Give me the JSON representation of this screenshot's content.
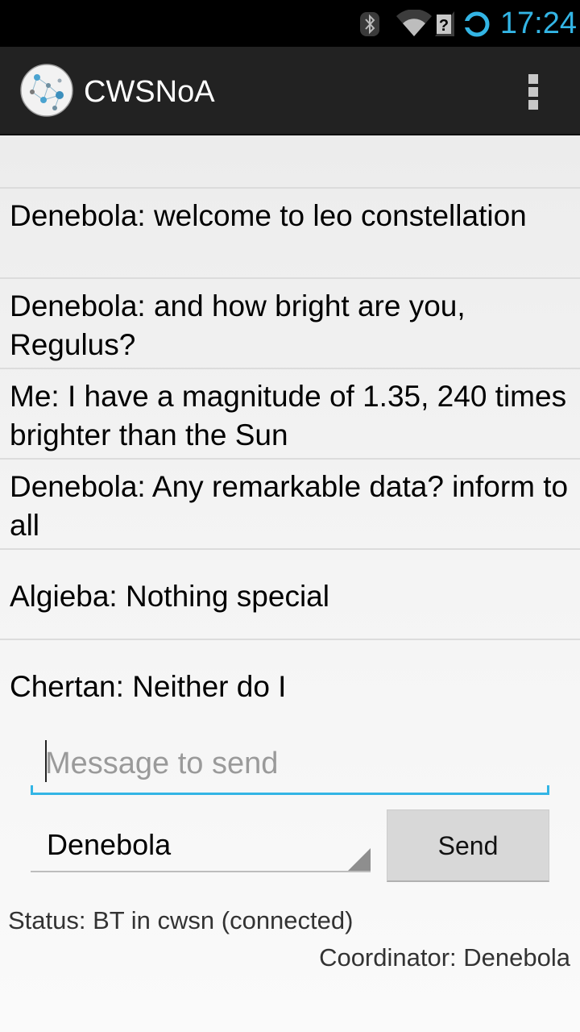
{
  "status_bar": {
    "time": "17:24",
    "icons": [
      "bluetooth-icon",
      "wifi-icon",
      "no-signal-icon",
      "sync-icon"
    ],
    "clock_color": "#33b5e5"
  },
  "app_bar": {
    "title": "CWSNoA",
    "logo_icon": "network-nodes-icon",
    "menu_icon": "overflow-menu-icon"
  },
  "messages": [
    {
      "text": "Denebola: welcome to leo constellation"
    },
    {
      "text": "Denebola: and how bright are you, Regulus?"
    },
    {
      "text": "Me: I have a magnitude of 1.35, 240 times brighter than the Sun"
    },
    {
      "text": "Denebola: Any remarkable data? inform to all"
    },
    {
      "text": "Algieba: Nothing special"
    },
    {
      "text": "Chertan: Neither do I"
    }
  ],
  "compose": {
    "placeholder": "Message to send",
    "value": "",
    "recipient": "Denebola",
    "send_label": "Send",
    "accent_color": "#33b5e5"
  },
  "footer": {
    "status": "Status: BT in cwsn (connected)",
    "coordinator": "Coordinator: Denebola"
  }
}
